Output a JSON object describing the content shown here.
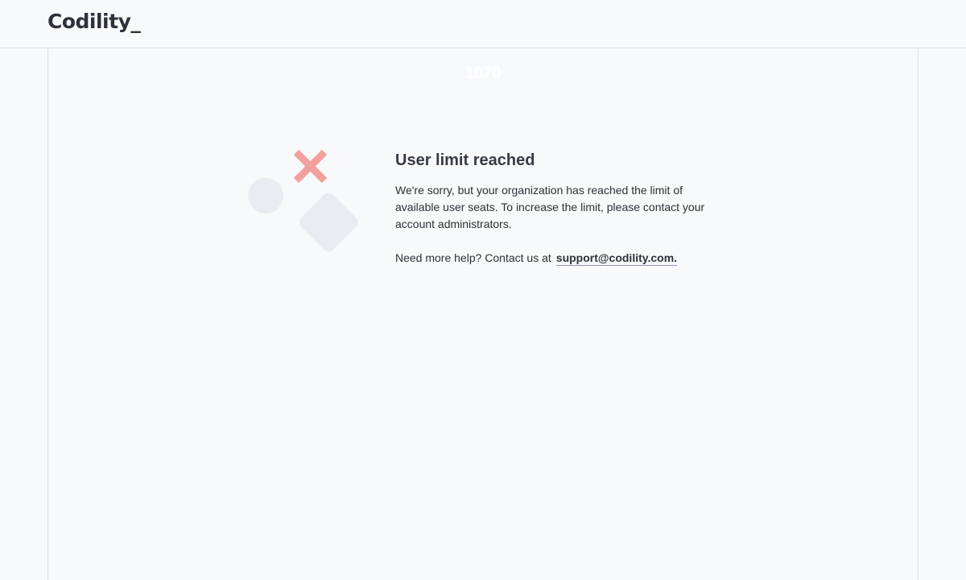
{
  "header": {
    "logo_text": "Codility_"
  },
  "overlay": {
    "number": "1070"
  },
  "error": {
    "title": "User limit reached",
    "message": "We're sorry, but your organization has reached the limit of available user seats. To increase the limit, please contact your account administrators.",
    "help_text": "Need more help? Contact us at",
    "support_email": "support@codility.com."
  },
  "icons": {
    "illustration": "error-illustration-icon",
    "cross": "cross-icon"
  },
  "colors": {
    "background": "#f8f9fb",
    "cross": "#f2a09c",
    "shapes": "#e8ebf0",
    "link_underline": "#8a94b8"
  }
}
